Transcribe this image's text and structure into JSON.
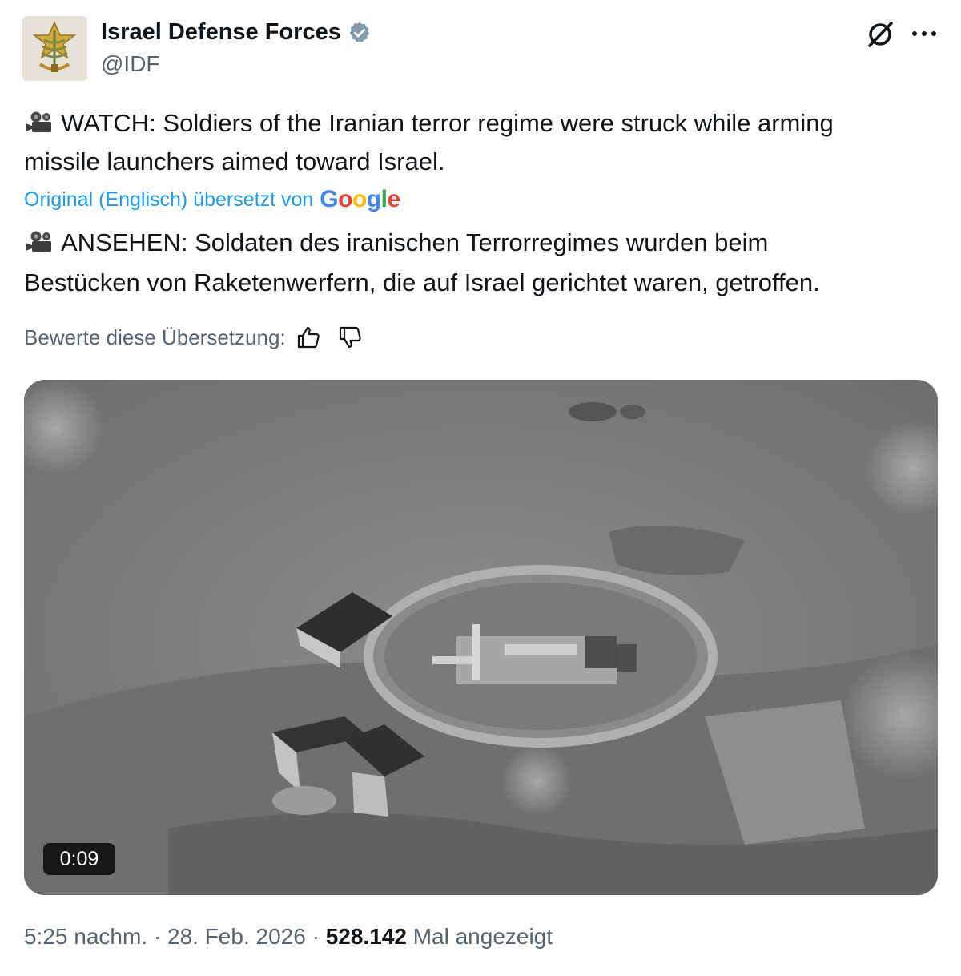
{
  "author": {
    "name": "Israel Defense Forces",
    "handle": "@IDF",
    "verified_color": "#829aab"
  },
  "tweet": {
    "text_lines": [
      "WATCH: Soldiers of the Iranian terror regime were struck while arming",
      "missile launchers aimed toward Israel."
    ]
  },
  "translation": {
    "notice": "Original (Englisch) übersetzt von",
    "provider": "Google",
    "text_lines": [
      "ANSEHEN: Soldaten des iranischen Terrorregimes wurden beim",
      "Bestücken von Raketenwerfern, die auf Israel gerichtet waren, getroffen."
    ],
    "rate_label": "Bewerte diese Übersetzung:"
  },
  "media": {
    "duration": "0:09"
  },
  "meta": {
    "time": "5:25 nachm.",
    "separator": "·",
    "date": "28. Feb. 2026",
    "views": "528.142",
    "views_label": "Mal angezeigt"
  },
  "colors": {
    "link": "#1d9bf0",
    "secondary_text": "#536471",
    "primary_text": "#0f1419"
  },
  "icons": [
    "idf-emblem-icon",
    "verified-badge-icon",
    "grok-icon",
    "more-icon",
    "video-camera-icon",
    "thumbs-up-icon",
    "thumbs-down-icon"
  ]
}
